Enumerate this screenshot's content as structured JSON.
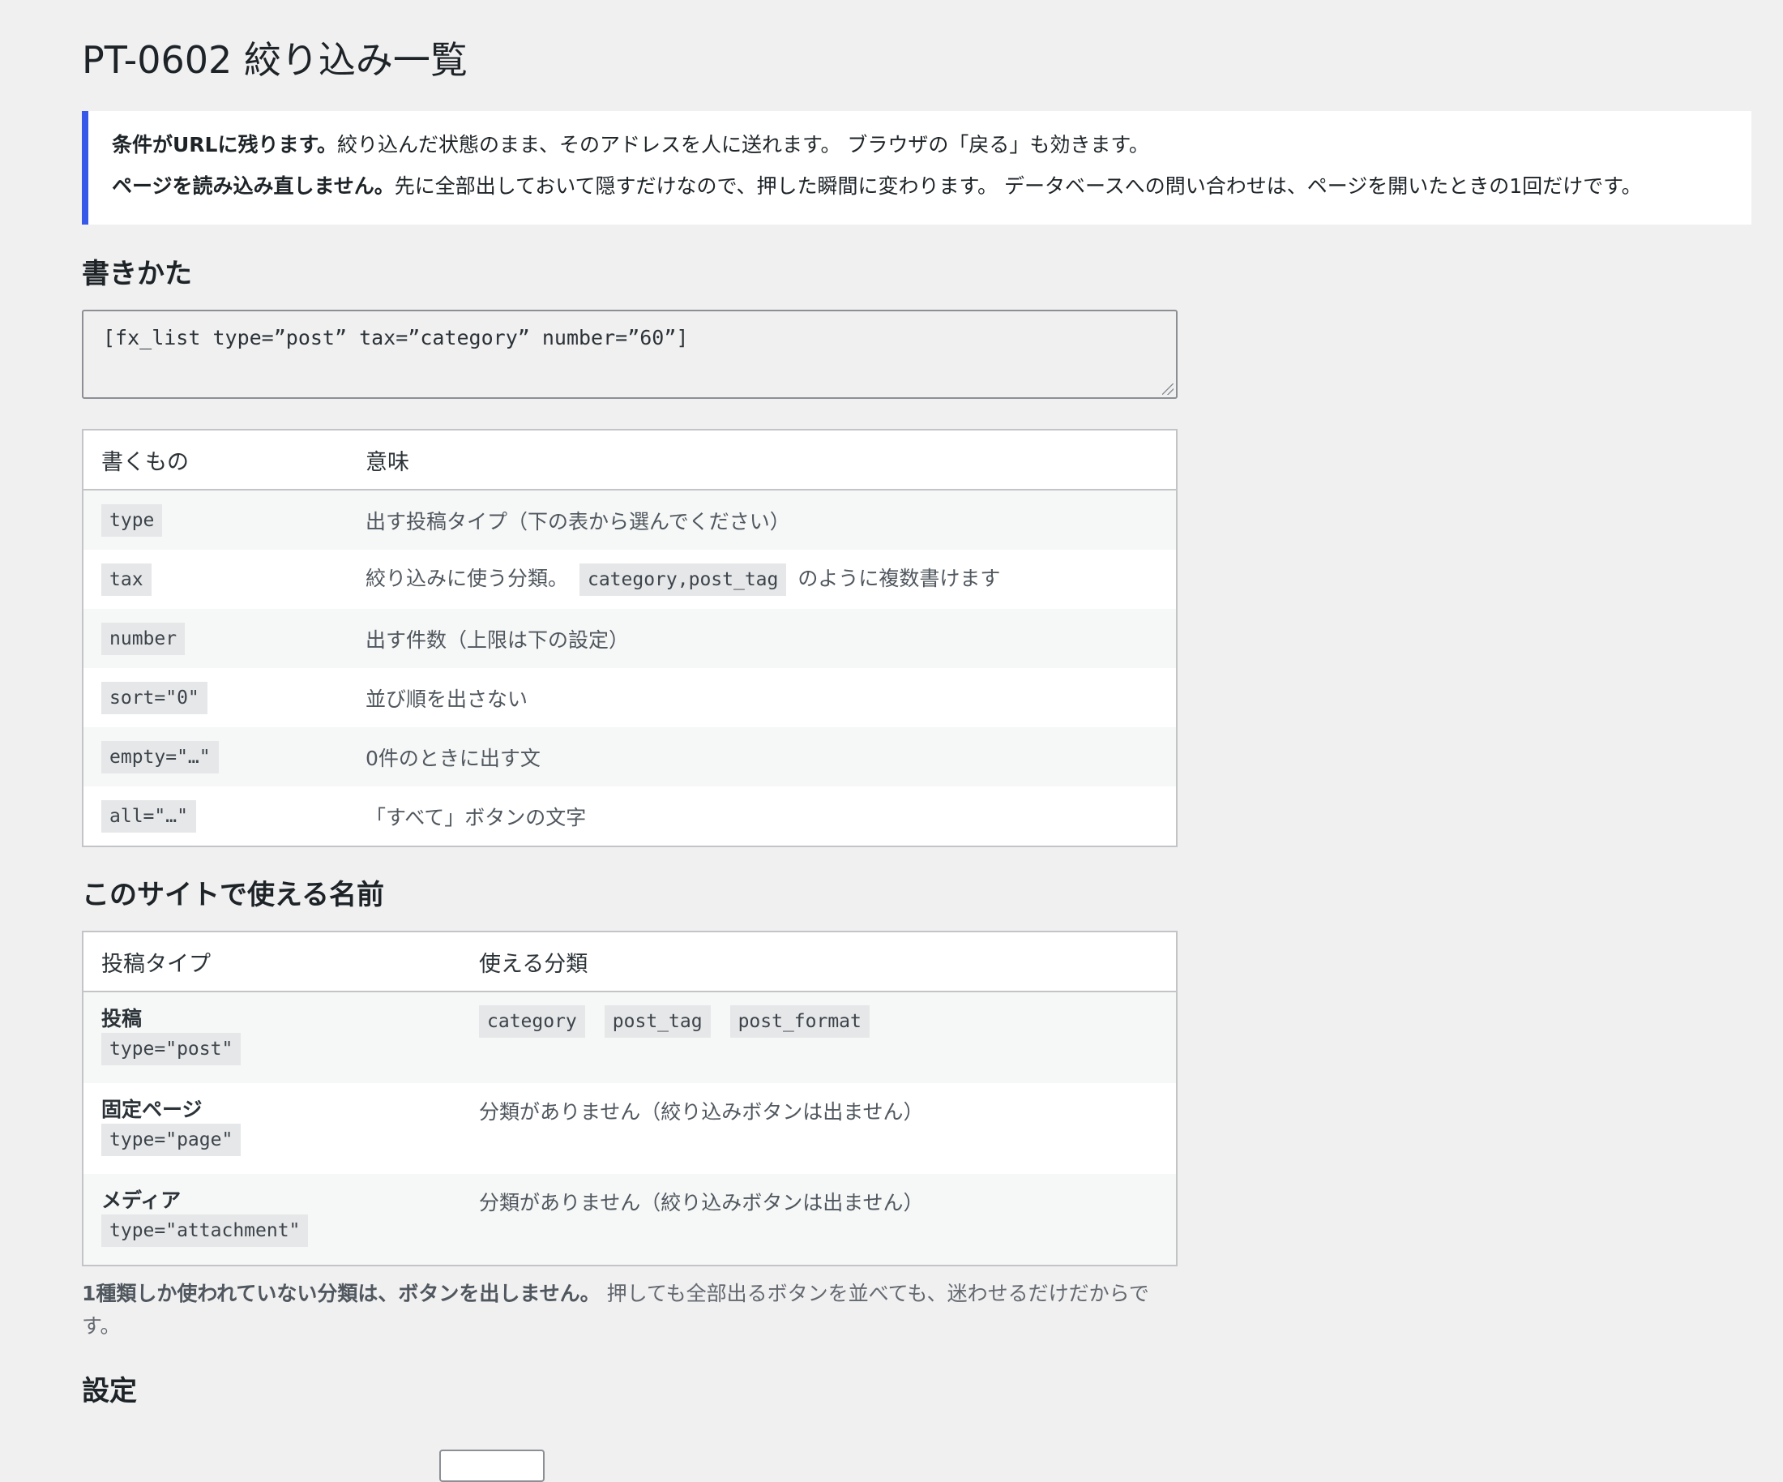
{
  "page": {
    "title": "PT-0602 絞り込み一覧"
  },
  "notice": {
    "line1_bold": "条件がURLに残ります。",
    "line1_rest": "絞り込んだ状態のまま、そのアドレスを人に送れます。 ブラウザの「戻る」も効きます。",
    "line2_bold": "ページを読み込み直しません。",
    "line2_rest": "先に全部出しておいて隠すだけなので、押した瞬間に変わります。 データベースへの問い合わせは、ページを開いたときの1回だけです。"
  },
  "usage": {
    "heading": "書きかた",
    "shortcode": "[fx_list type=”post” tax=”category” number=”60”]",
    "headers": [
      "書くもの",
      "意味"
    ],
    "rows": [
      {
        "key": "type",
        "desc": "出す投稿タイプ（下の表から選んでください）"
      },
      {
        "key": "tax",
        "desc_pre": "絞り込みに使う分類。",
        "desc_code": "category,post_tag",
        "desc_post": "のように複数書けます"
      },
      {
        "key": "number",
        "desc": "出す件数（上限は下の設定）"
      },
      {
        "key": "sort=\"0\"",
        "desc": "並び順を出さない"
      },
      {
        "key": "empty=\"…\"",
        "desc": "0件のときに出す文"
      },
      {
        "key": "all=\"…\"",
        "desc": "「すべて」ボタンの文字"
      }
    ]
  },
  "names": {
    "heading": "このサイトで使える名前",
    "headers": [
      "投稿タイプ",
      "使える分類"
    ],
    "rows": [
      {
        "name": "投稿",
        "code": "type=\"post\"",
        "taxes": [
          "category",
          "post_tag",
          "post_format"
        ]
      },
      {
        "name": "固定ページ",
        "code": "type=\"page\"",
        "none": "分類がありません（絞り込みボタンは出ません）"
      },
      {
        "name": "メディア",
        "code": "type=\"attachment\"",
        "none": "分類がありません（絞り込みボタンは出ません）"
      }
    ],
    "footnote_bold": "1種類しか使われていない分類は、ボタンを出しません。",
    "footnote_rest": " 押しても全部出るボタンを並べても、迷わせるだけだからです。"
  },
  "settings": {
    "heading": "設定"
  }
}
